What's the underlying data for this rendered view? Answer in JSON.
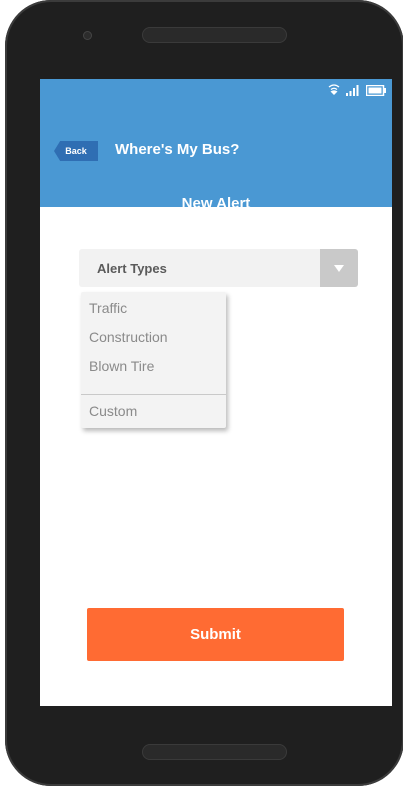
{
  "app": {
    "title": "Where's My Bus?",
    "back_label": "Back",
    "page_title": "New Alert"
  },
  "status_bar": {
    "icons": [
      "wifi-icon",
      "signal-icon",
      "battery-icon"
    ]
  },
  "alert_select": {
    "label": "Alert Types",
    "arrow_icon": "triangle-down-icon"
  },
  "dropdown": {
    "items": [
      "Traffic",
      "Construction",
      "Blown Tire"
    ],
    "custom": "Custom"
  },
  "submit_label": "Submit",
  "colors": {
    "header": "#4a98d3",
    "back_button": "#2f6eb3",
    "submit": "#ff6b33"
  }
}
